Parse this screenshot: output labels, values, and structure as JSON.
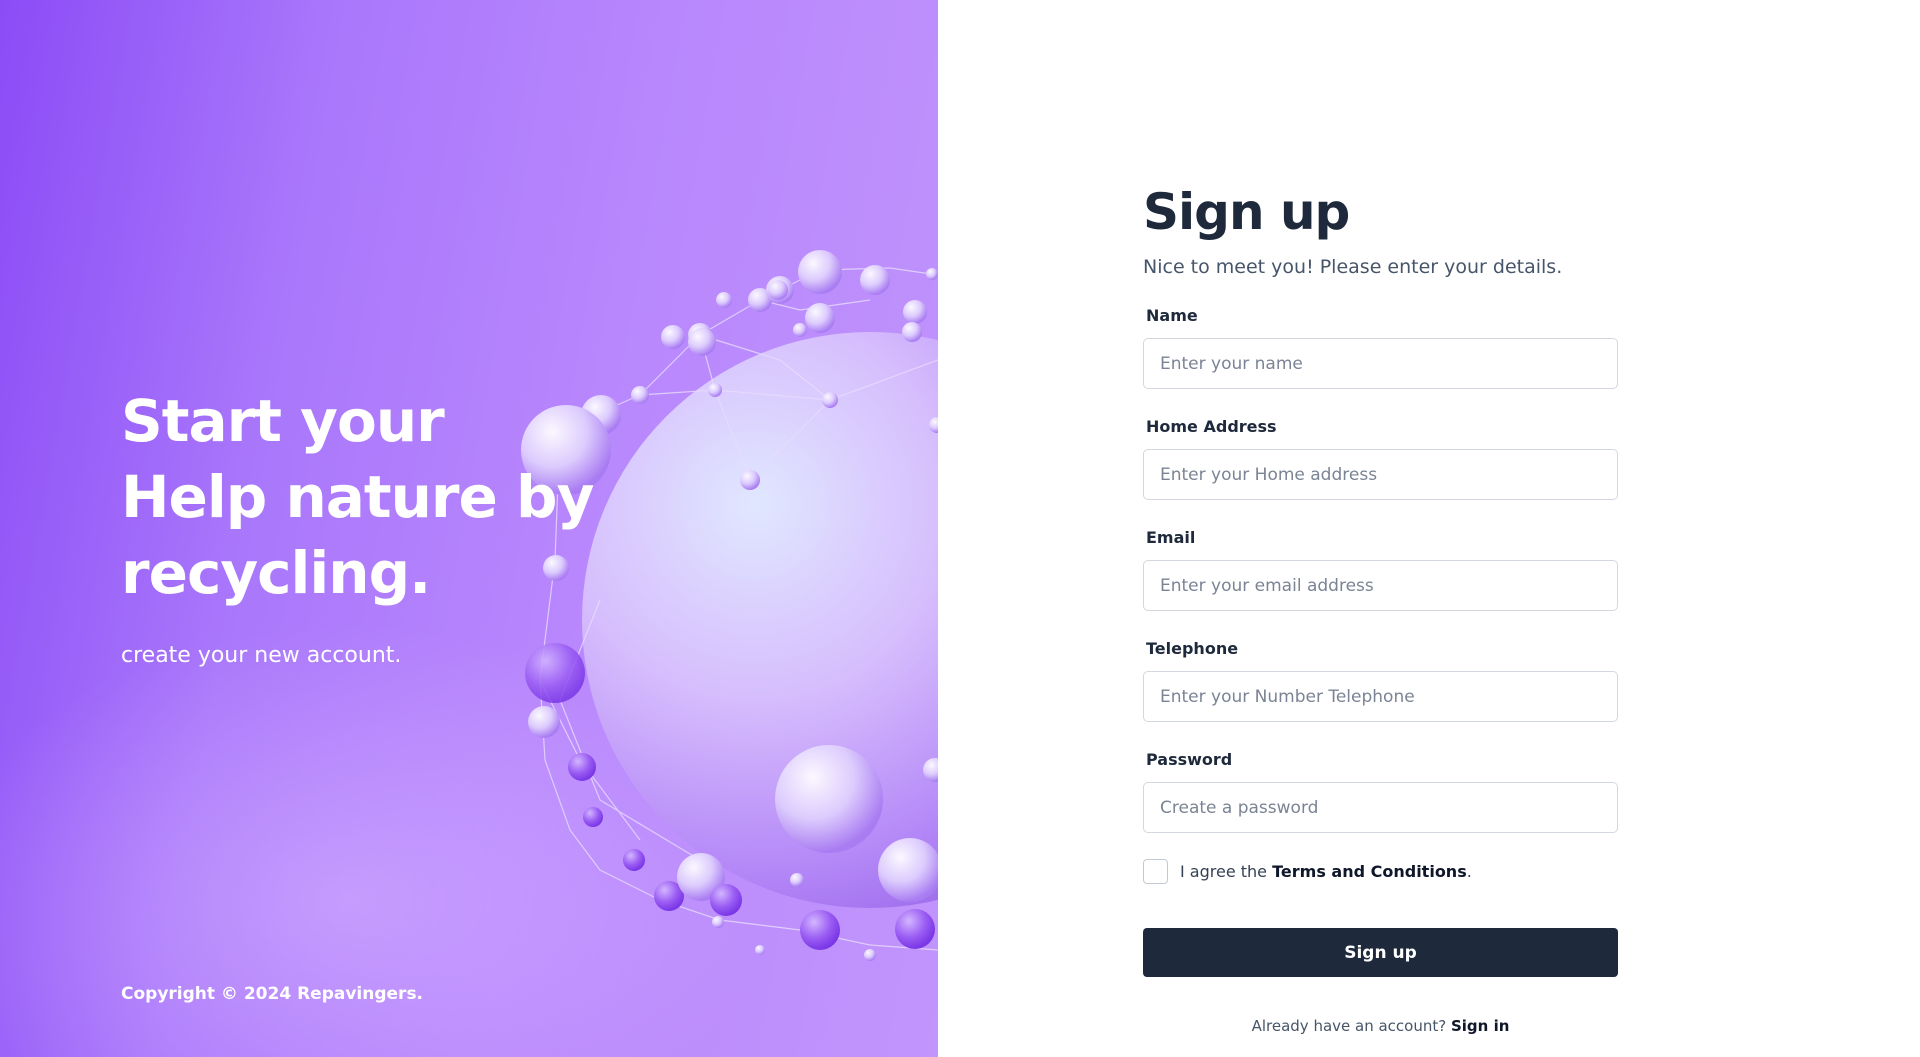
{
  "hero": {
    "title_lines": [
      "Start your",
      "Help nature by",
      "recycling."
    ],
    "subtitle": "create your new account.",
    "copyright": "Copyright © 2024 Repavingers."
  },
  "form": {
    "title": "Sign up",
    "subtitle": "Nice to meet you! Please enter your details.",
    "fields": [
      {
        "label": "Name",
        "placeholder": "Enter your name",
        "value": ""
      },
      {
        "label": "Home Address",
        "placeholder": "Enter your Home address",
        "value": ""
      },
      {
        "label": "Email",
        "placeholder": "Enter your email address",
        "value": ""
      },
      {
        "label": "Telephone",
        "placeholder": "Enter your Number Telephone",
        "value": ""
      },
      {
        "label": "Password",
        "placeholder": "Create a password",
        "value": ""
      }
    ],
    "agree": {
      "prefix": "I agree the ",
      "link": "Terms and Conditions",
      "suffix": ".",
      "checked": false
    },
    "submit_label": "Sign up",
    "signin": {
      "prompt": "Already have an account? ",
      "link": "Sign in"
    }
  },
  "colors": {
    "brand_purple": "#a977fb",
    "dark_button": "#1e293b",
    "input_border": "#d3d8df"
  },
  "icons": {
    "hero_art": "molecular-sphere-illustration"
  }
}
